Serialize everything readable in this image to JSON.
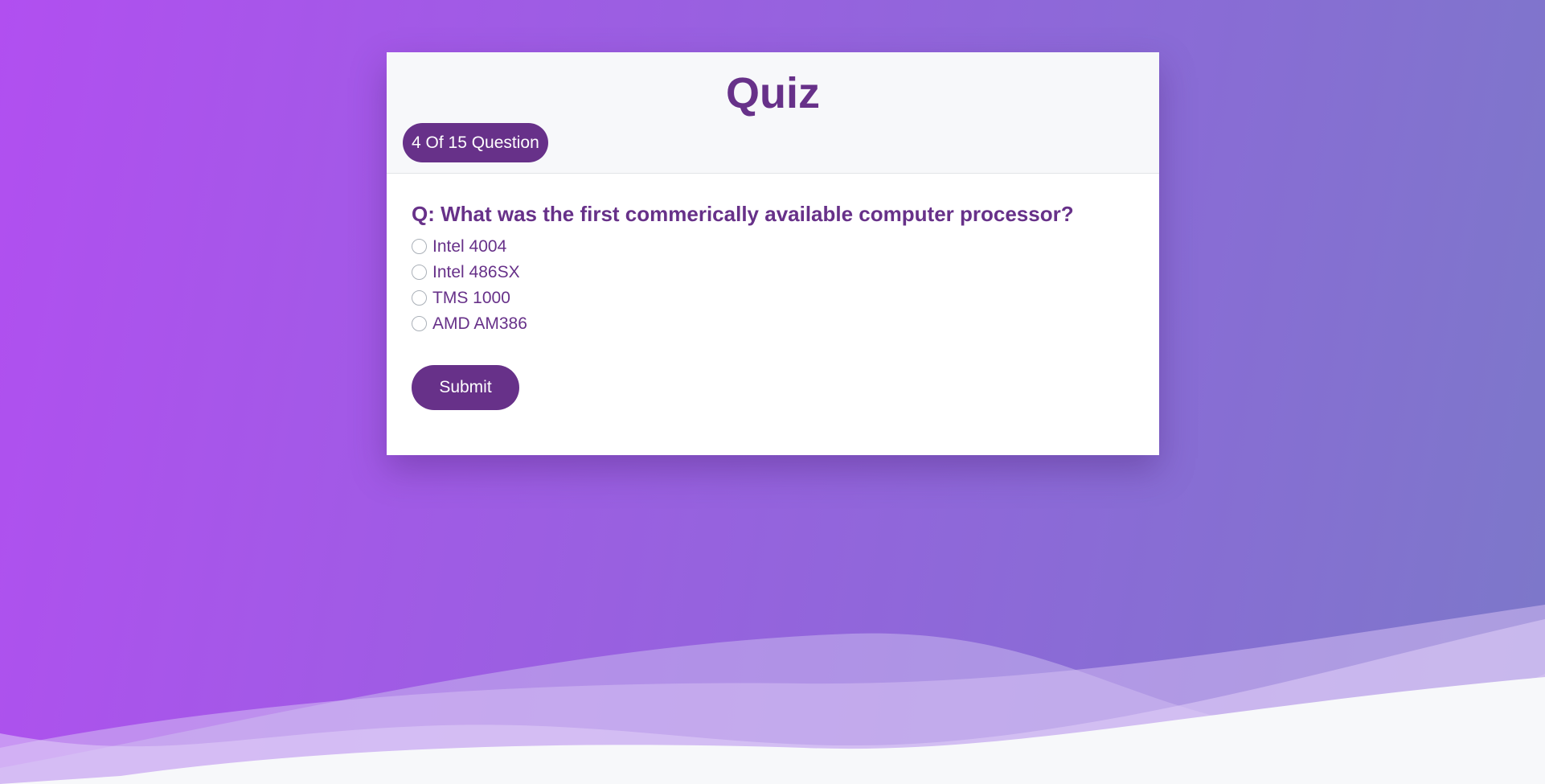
{
  "quiz": {
    "title": "Quiz",
    "progress": "4 Of 15 Question",
    "question": "Q: What was the first commerically available computer processor?",
    "options": [
      "Intel 4004",
      "Intel 486SX",
      "TMS 1000",
      "AMD AM386"
    ],
    "submit_label": "Submit"
  },
  "colors": {
    "accent": "#673189",
    "background_start": "#b14ff0",
    "background_end": "#7c78c9"
  }
}
